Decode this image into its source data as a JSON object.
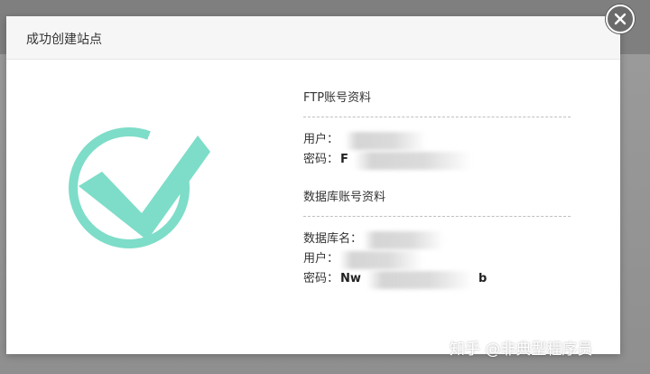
{
  "dialog": {
    "title": "成功创建站点"
  },
  "ftp": {
    "section_title": "FTP账号资料",
    "user_label": "用户：",
    "user_value": "",
    "password_label": "密码：",
    "password_value": "F"
  },
  "database": {
    "section_title": "数据库账号资料",
    "name_label": "数据库名：",
    "name_value": "",
    "user_label": "用户：",
    "user_value": "",
    "password_label": "密码：",
    "password_value": "Nw",
    "password_value_end": "b"
  },
  "watermark": "知乎 @非典型程序员",
  "colors": {
    "check": "#7dddc8",
    "header_bg": "#f6f6f6",
    "close_bg": "#6a6a6a"
  },
  "icons": {
    "close": "close-icon",
    "success": "check-circle-icon"
  }
}
